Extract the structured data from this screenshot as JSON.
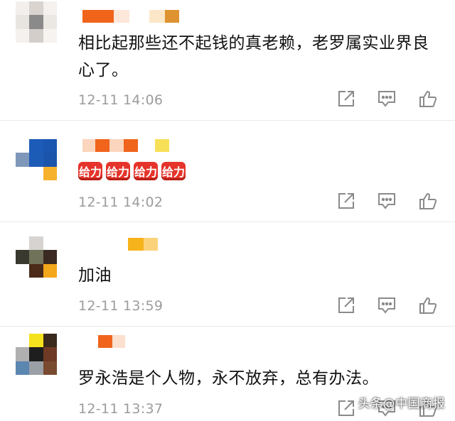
{
  "comments": [
    {
      "text": "相比起那些还不起钱的真老赖，老罗属实业界良心了。",
      "time": "12-11 14:06"
    },
    {
      "emoji_text": "给力",
      "time": "12-11 14:02"
    },
    {
      "text": "加油",
      "time": "12-11 13:59"
    },
    {
      "text": "罗永浩是个人物，永不放弃，总有办法。",
      "time": "12-11 13:37"
    }
  ],
  "icons": [
    "share-icon",
    "comment-icon",
    "like-icon"
  ],
  "watermark": "头条@中国商报",
  "colors": {
    "meta": "#9c9c9c",
    "emoji_bg": "#e5342b",
    "divider": "#e9e9e9"
  }
}
